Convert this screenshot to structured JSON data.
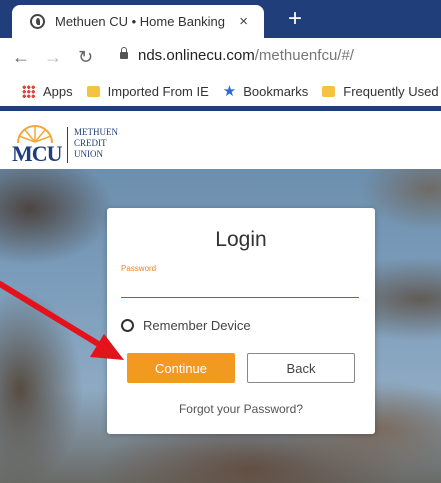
{
  "browser": {
    "tab_title": "Methuen CU • Home Banking",
    "tab_close": "×",
    "new_tab": "+",
    "url_host": "nds.onlinecu.com",
    "url_path": "/methuenfcu/#/"
  },
  "bookmarks": [
    {
      "label": "Apps",
      "icon": "apps-icon"
    },
    {
      "label": "Imported From IE",
      "icon": "folder-icon"
    },
    {
      "label": "Bookmarks",
      "icon": "star-icon"
    },
    {
      "label": "Frequently Used",
      "icon": "folder-icon"
    }
  ],
  "site": {
    "logo_mark": "MCU",
    "logo_line1": "METHUEN",
    "logo_line2": "CREDIT",
    "logo_line3": "UNION"
  },
  "login": {
    "title": "Login",
    "password_label": "Password",
    "password_value": "",
    "remember_label": "Remember Device",
    "continue_label": "Continue",
    "back_label": "Back",
    "forgot_label": "Forgot your Password?"
  },
  "colors": {
    "browser_navy": "#1f3e7a",
    "accent_orange": "#f29a1f",
    "input_underline": "#2a75c9",
    "arrow_red": "#e3121b"
  }
}
